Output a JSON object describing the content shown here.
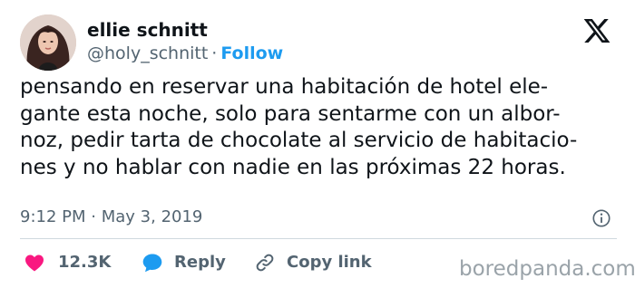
{
  "author": {
    "display_name": "ellie schnitt",
    "handle": "@holy_schnitt",
    "separator": "·",
    "follow_label": "Follow"
  },
  "tweet": {
    "text": "pensando en reservar una habitación de hotel ele-\ngante esta noche, solo para sentarme con un albor-\nnoz, pedir tarta de chocolate al servicio de habitacio-\nnes y no hablar con nadie en las próximas 22 horas.",
    "time": "9:12 PM",
    "date_separator": "·",
    "date": "May 3, 2019"
  },
  "actions": {
    "like_count": "12.3K",
    "reply_label": "Reply",
    "copy_link_label": "Copy link"
  },
  "watermark": "boredpanda.com",
  "icons": {
    "brand": "x-logo-icon",
    "info": "info-icon",
    "like": "heart-icon",
    "reply": "speech-bubble-icon",
    "copy": "link-icon"
  },
  "colors": {
    "follow": "#1d9bf0",
    "like_heart": "#f91880",
    "reply_bubble": "#1d9bf0",
    "muted_text": "#536471",
    "primary_text": "#0f1419"
  }
}
